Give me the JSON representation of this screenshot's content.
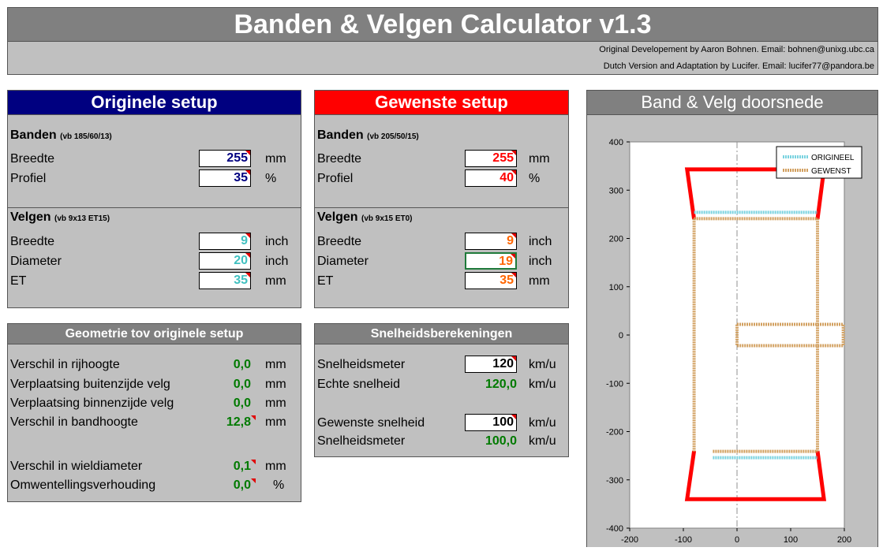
{
  "header": {
    "title": "Banden & Velgen Calculator v1.3",
    "credit_1": "Original Developement by Aaron Bohnen. Email: bohnen@unixg.ubc.ca",
    "credit_2": "Dutch Version and Adaptation by Lucifer. Email: lucifer77@pandora.be"
  },
  "original": {
    "title": "Originele setup",
    "tires_label": "Banden",
    "tires_hint": "(vb 185/60/13)",
    "width_label": "Breedte",
    "width_value": "255",
    "width_unit": "mm",
    "profile_label": "Profiel",
    "profile_value": "35",
    "profile_unit": "%",
    "rims_label": "Velgen",
    "rims_hint": "(vb 9x13 ET15)",
    "rim_width_label": "Breedte",
    "rim_width_value": "9",
    "rim_width_unit": "inch",
    "diameter_label": "Diameter",
    "diameter_value": "20",
    "diameter_unit": "inch",
    "et_label": "ET",
    "et_value": "35",
    "et_unit": "mm"
  },
  "desired": {
    "title": "Gewenste setup",
    "tires_label": "Banden",
    "tires_hint": "(vb 205/50/15)",
    "width_label": "Breedte",
    "width_value": "255",
    "width_unit": "mm",
    "profile_label": "Profiel",
    "profile_value": "40",
    "profile_unit": "%",
    "rims_label": "Velgen",
    "rims_hint": "(vb 9x15 ET0)",
    "rim_width_label": "Breedte",
    "rim_width_value": "9",
    "rim_width_unit": "inch",
    "diameter_label": "Diameter",
    "diameter_value": "19",
    "diameter_unit": "inch",
    "et_label": "ET",
    "et_value": "35",
    "et_unit": "mm"
  },
  "geometry": {
    "title": "Geometrie tov originele setup",
    "rows": [
      {
        "label": "Verschil in rijhoogte",
        "value": "0,0",
        "unit": "mm"
      },
      {
        "label": "Verplaatsing buitenzijde velg",
        "value": "0,0",
        "unit": "mm"
      },
      {
        "label": "Verplaatsing binnenzijde velg",
        "value": "0,0",
        "unit": "mm"
      },
      {
        "label": "Verschil in bandhoogte",
        "value": "12,8",
        "unit": "mm"
      },
      {
        "label": "Verschil in wieldiameter",
        "value": "0,1",
        "unit": "mm"
      },
      {
        "label": "Omwentellingsverhouding",
        "value": "0,0",
        "unit": "%"
      }
    ]
  },
  "speed": {
    "title": "Snelheidsberekeningen",
    "speedo_label": "Snelheidsmeter",
    "speedo_value": "120",
    "speedo_unit": "km/u",
    "real_label": "Echte snelheid",
    "real_value": "120,0",
    "real_unit": "km/u",
    "desired_label": "Gewenste snelheid",
    "desired_value": "100",
    "desired_unit": "km/u",
    "speedo2_label": "Snelheidsmeter",
    "speedo2_value": "100,0",
    "speedo2_unit": "km/u"
  },
  "chart": {
    "title": "Band & Velg doorsnede",
    "legend_original": "ORIGINEEL",
    "legend_desired": "GEWENST",
    "colors": {
      "original": "#7ad3e0",
      "desired": "#d2a060",
      "tire": "#ff0000"
    }
  },
  "chart_data": {
    "type": "line",
    "title": "Band & Velg doorsnede",
    "xlim": [
      -200,
      200
    ],
    "ylim": [
      -400,
      400
    ],
    "xticks": [
      "-200",
      "-100",
      "0",
      "100",
      "200"
    ],
    "yticks": [
      "400",
      "300",
      "200",
      "100",
      "0",
      "-100",
      "-200",
      "-300",
      "-400"
    ],
    "legend_position": "top-right",
    "tire_outline": {
      "top": [
        [
          -80,
          240
        ],
        [
          -93,
          343
        ],
        [
          162,
          343
        ],
        [
          150,
          240
        ]
      ],
      "bottom": [
        [
          -80,
          -240
        ],
        [
          -93,
          -340
        ],
        [
          162,
          -340
        ],
        [
          150,
          -240
        ]
      ]
    },
    "series": [
      {
        "name": "ORIGINEEL",
        "rim_top": [
          [
            -80,
            254
          ],
          [
            150,
            254
          ]
        ],
        "rim_bottom": [
          [
            -45,
            -254
          ],
          [
            150,
            -254
          ]
        ]
      },
      {
        "name": "GEWENST",
        "rim_top": [
          [
            -80,
            241
          ],
          [
            150,
            241
          ]
        ],
        "rim_bottom": [
          [
            -45,
            -241
          ],
          [
            150,
            -241
          ]
        ],
        "rim_sides_x": [
          -80,
          150
        ],
        "hub": {
          "x": [
            0,
            198
          ],
          "y": [
            -22,
            22
          ]
        }
      }
    ]
  }
}
